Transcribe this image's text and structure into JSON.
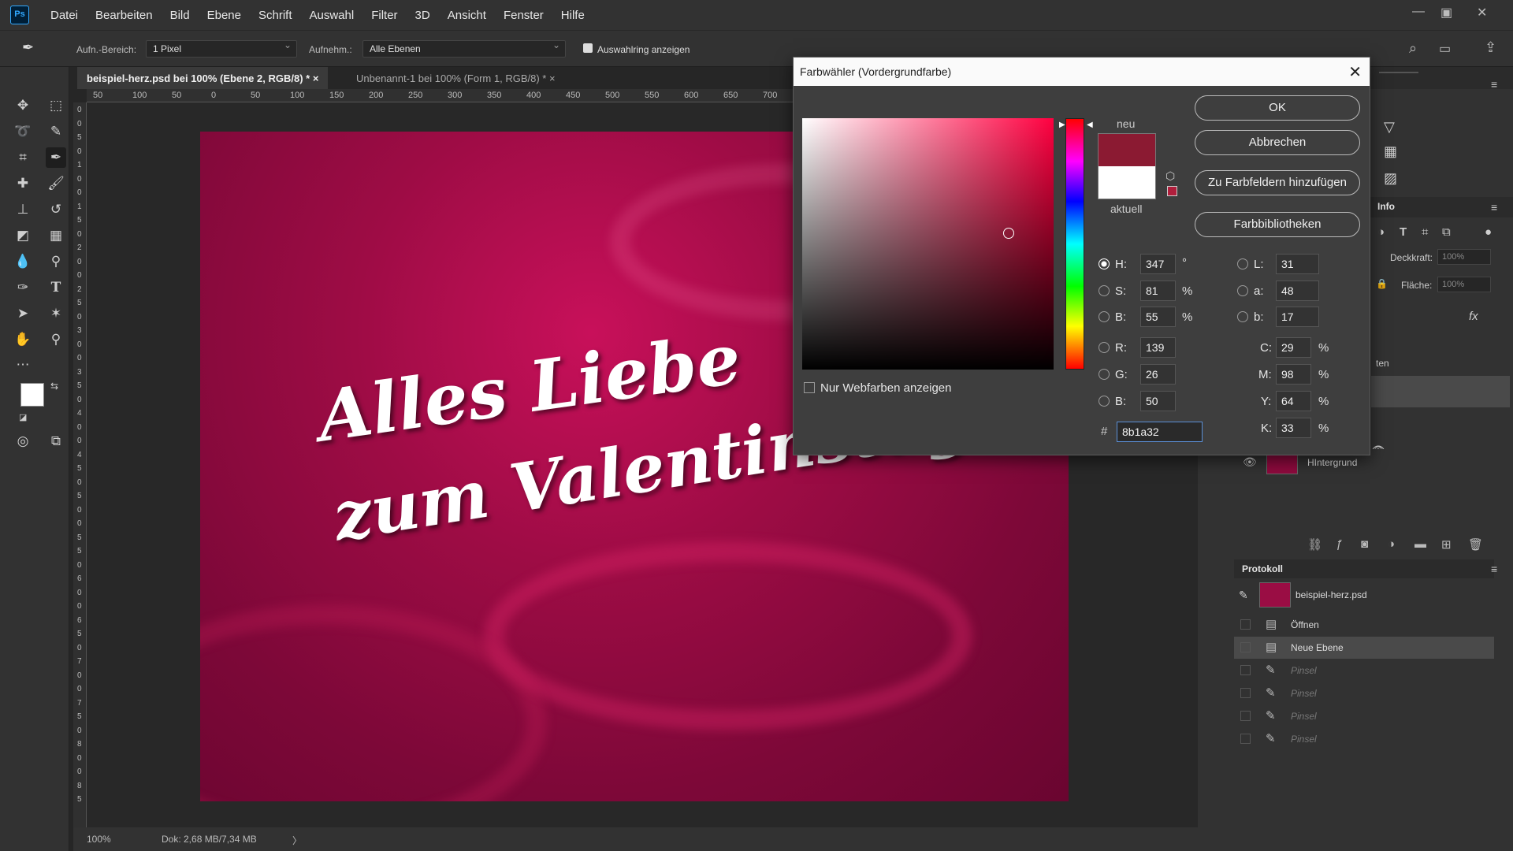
{
  "app": {
    "logo": "Ps"
  },
  "menu": [
    "Datei",
    "Bearbeiten",
    "Bild",
    "Ebene",
    "Schrift",
    "Auswahl",
    "Filter",
    "3D",
    "Ansicht",
    "Fenster",
    "Hilfe"
  ],
  "options": {
    "range_label": "Aufn.-Bereich:",
    "range_value": "1 Pixel",
    "sample_label": "Aufnehm.:",
    "sample_value": "Alle Ebenen",
    "ring_label": "Auswahlring anzeigen"
  },
  "tabs": [
    {
      "label": "beispiel-herz.psd bei 100% (Ebene 2, RGB/8) *",
      "close": "×"
    },
    {
      "label": "Unbenannt-1 bei 100% (Form 1, RGB/8) *",
      "close": "×"
    }
  ],
  "ruler_h": [
    "50",
    "100",
    "50",
    "0",
    "50",
    "100",
    "150",
    "200",
    "250",
    "300",
    "350",
    "400",
    "450",
    "500",
    "550",
    "600",
    "650",
    "700"
  ],
  "ruler_v": [
    "0",
    "0",
    "5",
    "0",
    "1",
    "0",
    "0",
    "1",
    "5",
    "0",
    "2",
    "0",
    "0",
    "2",
    "5",
    "0",
    "3",
    "0",
    "0",
    "3",
    "5",
    "0",
    "4",
    "0",
    "0",
    "4",
    "5",
    "0",
    "5",
    "0",
    "0",
    "5",
    "5",
    "0",
    "6",
    "0",
    "0",
    "6",
    "5",
    "0",
    "7",
    "0",
    "0",
    "7",
    "5",
    "0",
    "8",
    "0",
    "0",
    "8",
    "5"
  ],
  "canvas": {
    "line1": "Alles Liebe",
    "line2": "zum Valentinstag"
  },
  "status": {
    "zoom": "100%",
    "doc": "Dok: 2,68 MB/7,34 MB",
    "arrow": "〉"
  },
  "dialog": {
    "title": "Farbwähler (Vordergrundfarbe)",
    "close": "✕",
    "ok": "OK",
    "cancel": "Abbrechen",
    "add_swatch": "Zu Farbfeldern hinzufügen",
    "libraries": "Farbbibliotheken",
    "new_label": "neu",
    "current_label": "aktuell",
    "web_only": "Nur Webfarben anzeigen",
    "new_color": "#8b1a32",
    "current_color": "#ffffff",
    "hsb": [
      {
        "label": "H:",
        "value": "347",
        "unit": "°",
        "selected": true
      },
      {
        "label": "S:",
        "value": "81",
        "unit": "%",
        "selected": false
      },
      {
        "label": "B:",
        "value": "55",
        "unit": "%",
        "selected": false
      }
    ],
    "rgb": [
      {
        "label": "R:",
        "value": "139"
      },
      {
        "label": "G:",
        "value": "26"
      },
      {
        "label": "B:",
        "value": "50"
      }
    ],
    "lab": [
      {
        "label": "L:",
        "value": "31"
      },
      {
        "label": "a:",
        "value": "48"
      },
      {
        "label": "b:",
        "value": "17"
      }
    ],
    "cmyk": [
      {
        "label": "C:",
        "value": "29",
        "unit": "%"
      },
      {
        "label": "M:",
        "value": "98",
        "unit": "%"
      },
      {
        "label": "Y:",
        "value": "64",
        "unit": "%"
      },
      {
        "label": "K:",
        "value": "33",
        "unit": "%"
      }
    ],
    "hex_label": "#",
    "hex_value": "8b1a32"
  },
  "layers": {
    "info_label": "Info",
    "opacity_label": "Deckkraft:",
    "opacity_value": "100%",
    "fill_label": "Fläche:",
    "fill_value": "100%",
    "fx_label": "fx",
    "partial_label": "ten",
    "background_layer": "HIntergrund"
  },
  "history": {
    "title": "Protokoll",
    "snapshot": "beispiel-herz.psd",
    "items": [
      {
        "label": "Öffnen",
        "state": "active"
      },
      {
        "label": "Neue Ebene",
        "state": "selected"
      },
      {
        "label": "Pinsel",
        "state": "undone"
      },
      {
        "label": "Pinsel",
        "state": "undone"
      },
      {
        "label": "Pinsel",
        "state": "undone"
      },
      {
        "label": "Pinsel",
        "state": "undone"
      }
    ]
  },
  "colors": {
    "accent": "#31a8ff",
    "foreground": "#ffffff",
    "background_swatch": "#e0457a"
  }
}
